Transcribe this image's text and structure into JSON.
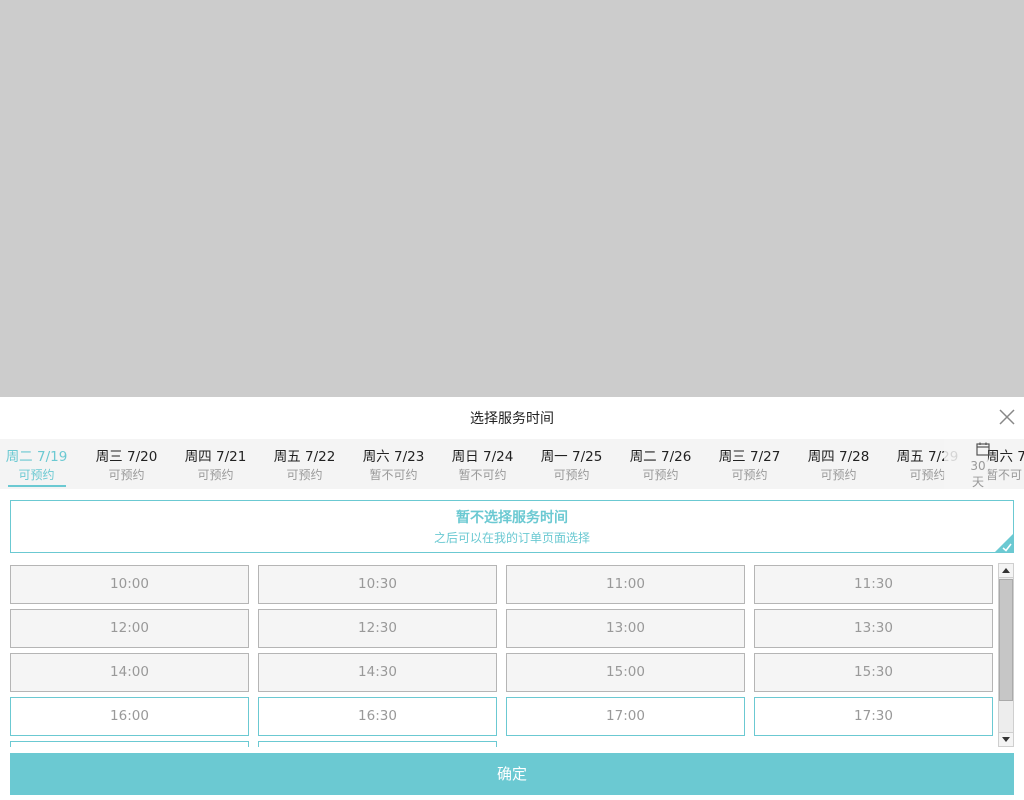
{
  "sheet": {
    "title": "选择服务时间"
  },
  "dates": [
    {
      "label": "周二 7/19",
      "status": "可预约",
      "active": true
    },
    {
      "label": "周三 7/20",
      "status": "可预约"
    },
    {
      "label": "周四 7/21",
      "status": "可预约"
    },
    {
      "label": "周五 7/22",
      "status": "可预约"
    },
    {
      "label": "周六 7/23",
      "status": "暂不可约"
    },
    {
      "label": "周日 7/24",
      "status": "暂不可约"
    },
    {
      "label": "周一 7/25",
      "status": "可预约"
    },
    {
      "label": "周二 7/26",
      "status": "可预约"
    },
    {
      "label": "周三 7/27",
      "status": "可预约"
    },
    {
      "label": "周四 7/28",
      "status": "可预约"
    },
    {
      "label": "周五 7/29",
      "status": "可预约"
    },
    {
      "label": "周六 7",
      "status": "暂不可"
    }
  ],
  "calendar": {
    "label": "30天",
    "icon": "calendar-icon"
  },
  "no_time": {
    "title": "暂不选择服务时间",
    "subtitle": "之后可以在我的订单页面选择",
    "icon": "check-corner-icon"
  },
  "slots": [
    {
      "time": "10:00",
      "available": false
    },
    {
      "time": "10:30",
      "available": false
    },
    {
      "time": "11:00",
      "available": false
    },
    {
      "time": "11:30",
      "available": false
    },
    {
      "time": "12:00",
      "available": false
    },
    {
      "time": "12:30",
      "available": false
    },
    {
      "time": "13:00",
      "available": false
    },
    {
      "time": "13:30",
      "available": false
    },
    {
      "time": "14:00",
      "available": false
    },
    {
      "time": "14:30",
      "available": false
    },
    {
      "time": "15:00",
      "available": false
    },
    {
      "time": "15:30",
      "available": false
    },
    {
      "time": "16:00",
      "available": true
    },
    {
      "time": "16:30",
      "available": true
    },
    {
      "time": "17:00",
      "available": true
    },
    {
      "time": "17:30",
      "available": true
    },
    {
      "time": "",
      "available": true
    },
    {
      "time": "",
      "available": true
    }
  ],
  "confirm": {
    "label": "确定"
  },
  "colors": {
    "accent": "#6bc9d2",
    "overlay": "#cccccc",
    "disabled_bg": "#f5f5f5",
    "muted_text": "#999999"
  }
}
